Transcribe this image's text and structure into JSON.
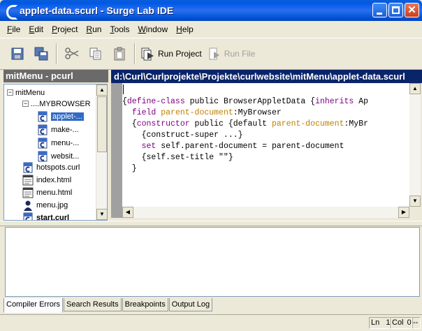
{
  "window": {
    "title": "applet-data.scurl - Surge Lab IDE"
  },
  "menu": [
    "File",
    "Edit",
    "Project",
    "Run",
    "Tools",
    "Window",
    "Help"
  ],
  "menu_mnemonics": [
    "F",
    "E",
    "P",
    "R",
    "T",
    "W",
    "H"
  ],
  "toolbar": {
    "run_project": "Run Project",
    "run_file": "Run File"
  },
  "left_panel": {
    "title": "mitMenu - pcurl"
  },
  "tree": {
    "root": "mitMenu",
    "folder": "....MYBROWSER",
    "folder_items": [
      "applet-...",
      "make-...",
      "menu-...",
      "websit..."
    ],
    "files": [
      "hotspots.curl",
      "index.html",
      "menu.html",
      "menu.jpg",
      "start.curl"
    ]
  },
  "editor": {
    "path": "d:\\Curl\\Curlprojekte\\Projekte\\curlwebsite\\mitMenu\\applet-data.scurl",
    "lines": [
      [],
      [
        [
          "{",
          ""
        ],
        [
          "define-class",
          "kw"
        ],
        [
          " public BrowserAppletData {",
          ""
        ],
        [
          "inherits",
          "kw"
        ],
        [
          " Ap",
          ""
        ]
      ],
      [
        [
          "  ",
          ""
        ],
        [
          "field",
          "kw"
        ],
        [
          " ",
          ""
        ],
        [
          "parent-document",
          "nm"
        ],
        [
          ":MyBrowser",
          ""
        ]
      ],
      [
        [
          "  {",
          ""
        ],
        [
          "constructor",
          "kw"
        ],
        [
          " public {default ",
          ""
        ],
        [
          "parent-document",
          "nm"
        ],
        [
          ":MyBr",
          ""
        ]
      ],
      [
        [
          "    {construct-super ...}",
          ""
        ]
      ],
      [
        [
          "    ",
          ""
        ],
        [
          "set",
          "kw"
        ],
        [
          " self.parent-document = parent-document",
          ""
        ]
      ],
      [
        [
          "    {self.set-title \"\"}",
          ""
        ]
      ],
      [
        [
          "  }",
          ""
        ]
      ]
    ]
  },
  "bottom_tabs": [
    "Compiler Errors",
    "Search Results",
    "Breakpoints",
    "Output Log"
  ],
  "status": {
    "ln_label": "Ln",
    "ln_value": "1",
    "col_label": "Col",
    "col_value": "0",
    "extra": "--"
  },
  "colors": {
    "keyword": "#800080",
    "name": "#c08000",
    "title_bar": "#0058e6",
    "selection": "#316ac5"
  }
}
